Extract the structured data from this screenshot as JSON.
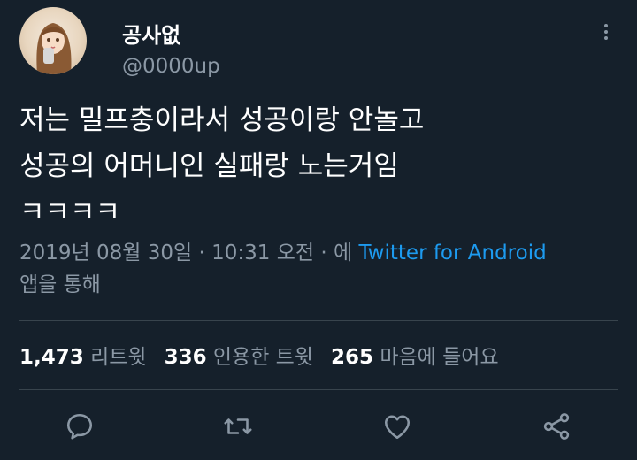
{
  "user": {
    "name": "공사없",
    "handle": "@0000up"
  },
  "tweet": {
    "lines": [
      "저는 밀프충이라서 성공이랑 안놀고",
      "성공의 어머니인 실패랑 노는거임",
      "ㅋㅋㅋㅋ"
    ]
  },
  "meta": {
    "date": "2019년 08월 30일",
    "sep1": " · ",
    "time": "10:31 오전",
    "sep2": " · 에 ",
    "app": "Twitter for Android",
    "suffix": "앱을 통해"
  },
  "stats": [
    {
      "count": "1,473",
      "label": "리트윗"
    },
    {
      "count": "336",
      "label": "인용한 트윗"
    },
    {
      "count": "265",
      "label": "마음에 들어요"
    }
  ],
  "colors": {
    "background": "#15202b",
    "muted": "#8b98a5",
    "accent": "#1d9bf0",
    "divider": "#38444d"
  },
  "actions": [
    "reply-icon",
    "retweet-icon",
    "like-icon",
    "share-icon"
  ]
}
